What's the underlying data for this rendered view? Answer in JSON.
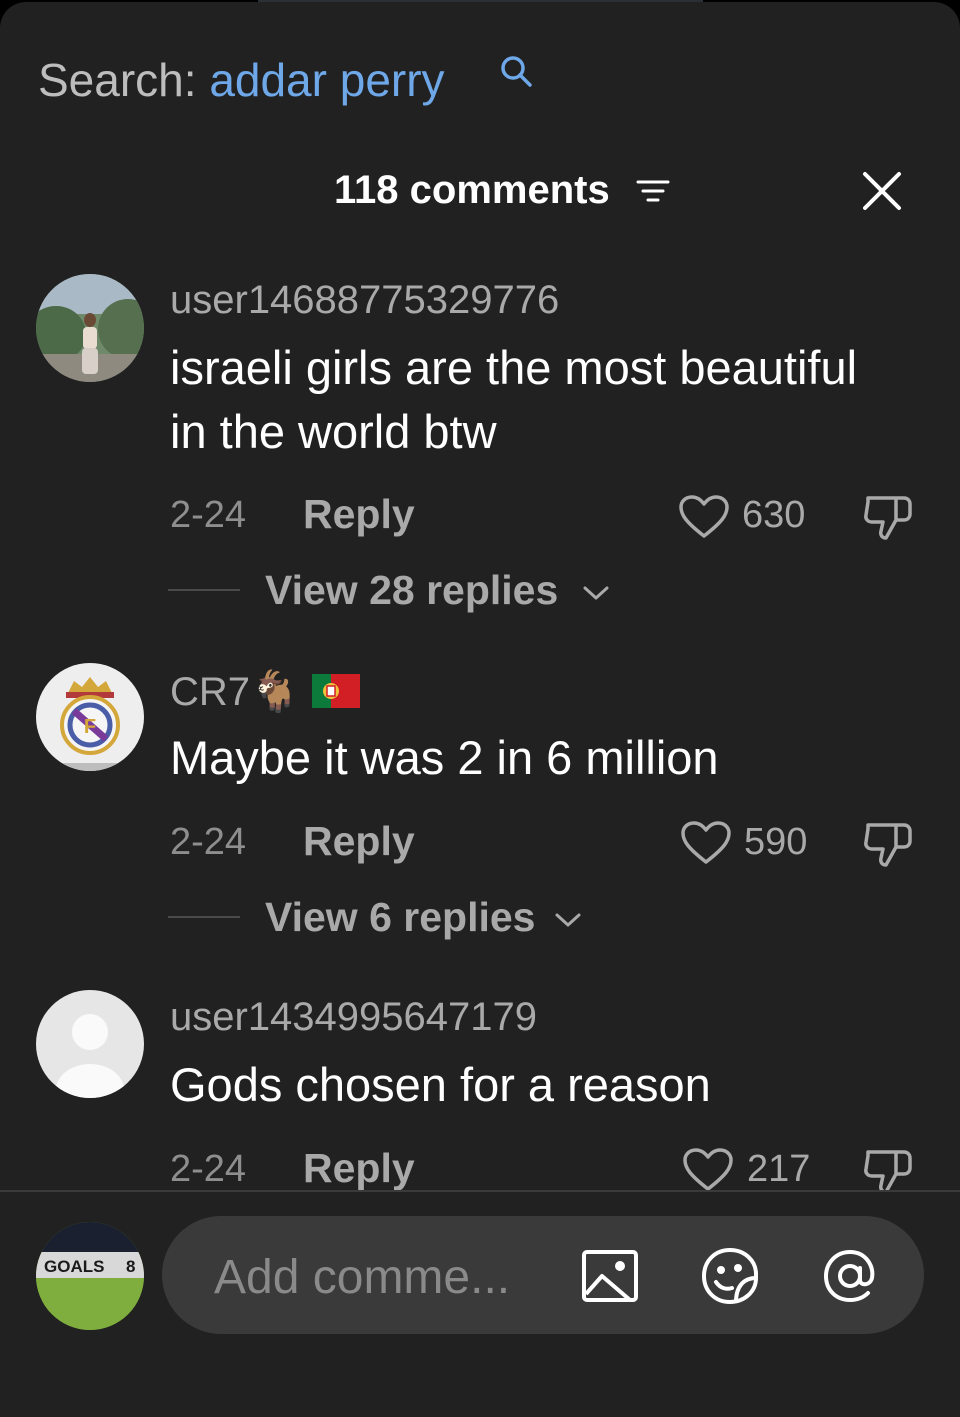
{
  "search": {
    "label": "Search: ",
    "query": "addar perry"
  },
  "header": {
    "comment_count": "118 comments"
  },
  "comments": [
    {
      "username": "user14688775329776",
      "text": "israeli girls are the most beautiful in the world btw",
      "date": "2-24",
      "reply_label": "Reply",
      "likes": "630",
      "view_replies": "View 28 replies"
    },
    {
      "username": "CR7",
      "username_emoji": "🐐",
      "text": "Maybe it was 2 in 6 million",
      "date": "2-24",
      "reply_label": "Reply",
      "likes": "590",
      "view_replies": "View 6 replies"
    },
    {
      "username": "user1434995647179",
      "text": "Gods chosen for a reason",
      "date": "2-24",
      "reply_label": "Reply",
      "likes": "217"
    }
  ],
  "composer": {
    "placeholder": "Add comme...",
    "avatar_text": "GOALS",
    "avatar_num": "8"
  },
  "icons": {
    "search": "search-icon",
    "filter": "filter-icon",
    "close": "close-icon",
    "like": "heart-icon",
    "dislike": "thumbs-down-icon",
    "chevron": "chevron-down-icon",
    "image": "image-icon",
    "emoji": "emoji-sticker-icon",
    "mention": "at-mention-icon"
  },
  "colors": {
    "background": "#212121",
    "link": "#6fa8e8",
    "muted": "#a9a9a9"
  }
}
